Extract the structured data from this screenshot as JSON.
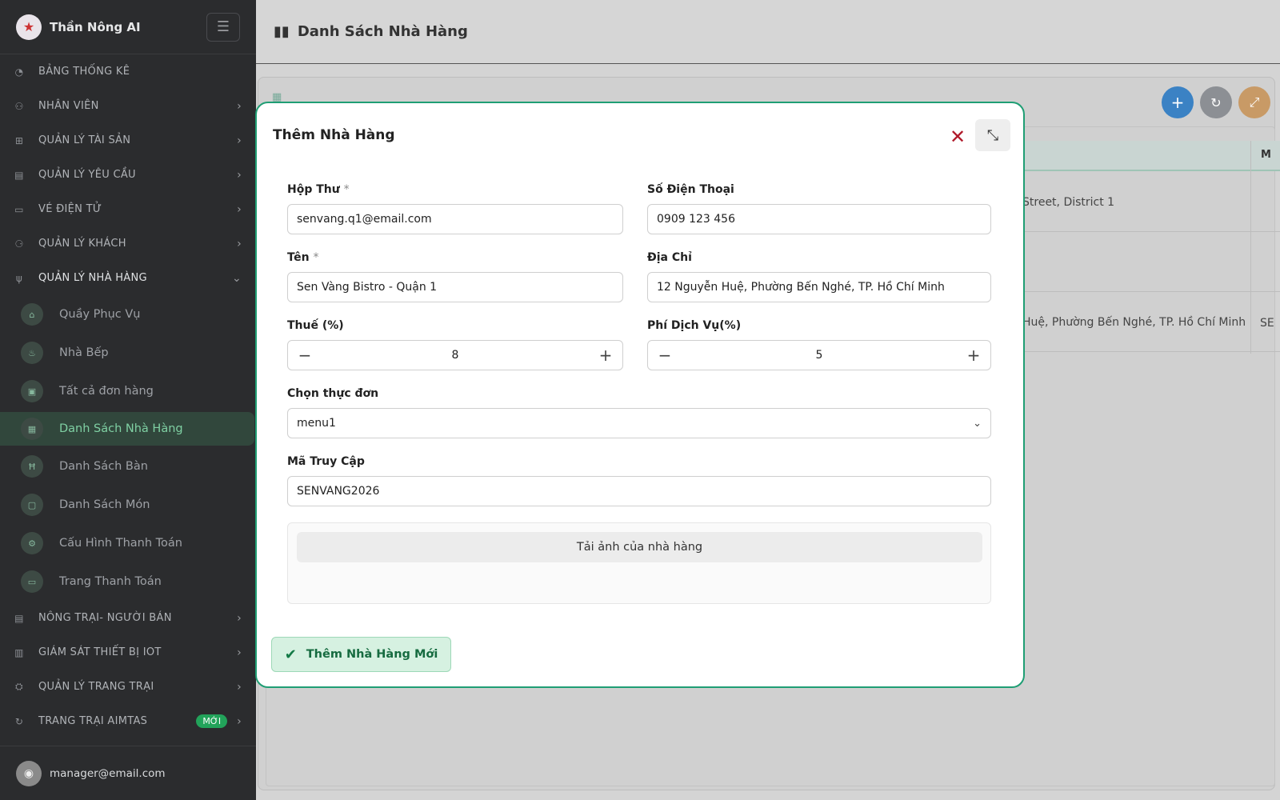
{
  "brand": {
    "name": "Thần Nông AI",
    "menu_icon": "hamburger-icon"
  },
  "header": {
    "title": "Danh Sách Nhà Hàng",
    "icon": "bar-chart-icon"
  },
  "sidebar": {
    "items": [
      {
        "label": "BẢNG THỐNG KÊ",
        "icon": "gauge-icon",
        "has_children": false
      },
      {
        "label": "NHÂN VIÊN",
        "icon": "team-icon",
        "has_children": true
      },
      {
        "label": "QUẢN LÝ TÀI SẢN",
        "icon": "sitemap-icon",
        "has_children": true
      },
      {
        "label": "QUẢN LÝ YÊU CẦU",
        "icon": "clipboard-icon",
        "has_children": true
      },
      {
        "label": "VÉ ĐIỆN TỬ",
        "icon": "ticket-icon",
        "has_children": true
      },
      {
        "label": "QUẢN LÝ KHÁCH",
        "icon": "users-icon",
        "has_children": true
      },
      {
        "label": "QUẢN LÝ NHÀ HÀNG",
        "icon": "cutlery-icon",
        "has_children": true,
        "open": true
      }
    ],
    "sub_items": [
      {
        "label": "Quầy Phục Vụ",
        "icon": "counter-icon"
      },
      {
        "label": "Nhà Bếp",
        "icon": "flame-icon"
      },
      {
        "label": "Tất cả đơn hàng",
        "icon": "cart-icon"
      },
      {
        "label": "Danh Sách Nhà Hàng",
        "icon": "store-icon",
        "active": true
      },
      {
        "label": "Danh Sách Bàn",
        "icon": "table-icon"
      },
      {
        "label": "Danh Sách Món",
        "icon": "dish-icon"
      },
      {
        "label": "Cấu Hình Thanh Toán",
        "icon": "settings-payment-icon"
      },
      {
        "label": "Trang Thanh Toán",
        "icon": "credit-card-icon"
      }
    ],
    "items_after": [
      {
        "label": "NÔNG TRẠI- NGƯỜI BÁN",
        "icon": "shop-icon",
        "has_children": true
      },
      {
        "label": "GIÁM SÁT THIẾT BỊ IOT",
        "icon": "chart-icon",
        "has_children": true
      },
      {
        "label": "QUẢN LÝ TRANG TRẠI",
        "icon": "tractor-icon",
        "has_children": true
      },
      {
        "label": "TRANG TRẠI AIMTAS",
        "icon": "cow-icon",
        "has_children": true,
        "badge": "MỚI"
      }
    ],
    "user_email": "manager@email.com"
  },
  "background_table": {
    "header_extra": "M",
    "rows": [
      {
        "address": "Street, District 1",
        "extra": ""
      },
      {
        "address": "",
        "extra": ""
      },
      {
        "address": "Huệ, Phường Bến Nghé, TP. Hồ Chí Minh",
        "extra": "SE"
      }
    ]
  },
  "modal": {
    "title": "Thêm Nhà Hàng",
    "email": {
      "label": "Hộp Thư",
      "required": "*",
      "value": "senvang.q1@email.com"
    },
    "phone": {
      "label": "Số Điện Thoại",
      "value": "0909 123 456"
    },
    "name": {
      "label": "Tên",
      "required": "*",
      "value": "Sen Vàng Bistro - Quận 1"
    },
    "address": {
      "label": "Địa Chỉ",
      "value": "12 Nguyễn Huệ, Phường Bến Nghé, TP. Hồ Chí Minh"
    },
    "tax": {
      "label": "Thuế (%)",
      "value": "8"
    },
    "service_fee": {
      "label": "Phí Dịch Vụ(%)",
      "value": "5"
    },
    "menu": {
      "label": "Chọn thực đơn",
      "value": "menu1"
    },
    "access_code": {
      "label": "Mã Truy Cập",
      "value": "SENVANG2026"
    },
    "upload_label": "Tải ảnh của nhà hàng",
    "submit_label": "Thêm Nhà Hàng Mới"
  },
  "colors": {
    "accent": "#1f9e74",
    "sidebar_bg": "#2b2c2e",
    "close": "#b0192a",
    "badge": "#22a35a"
  }
}
